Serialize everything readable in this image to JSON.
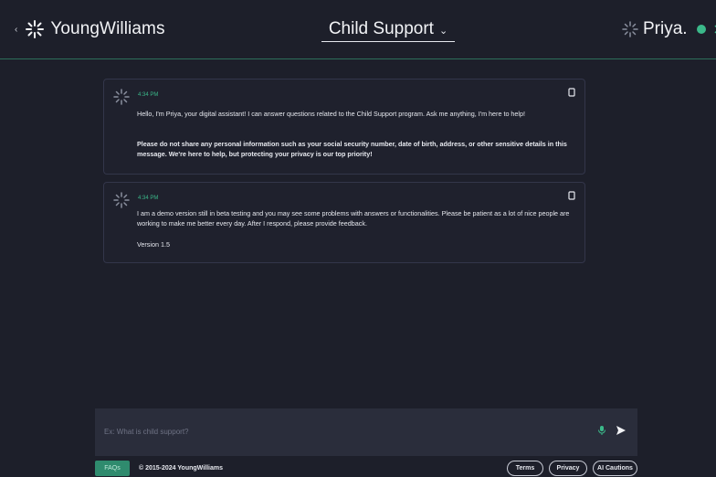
{
  "header": {
    "brand": "YoungWilliams",
    "title": "Child Support",
    "assistant_name": "Priya."
  },
  "messages": [
    {
      "time": "4:34 PM",
      "paragraphs": [
        "Hello, I'm Priya, your digital assistant! I can answer questions related to the Child Support program. Ask me anything, I'm here to help!",
        "Please do not share any personal information such as your social security number, date of birth, address, or other sensitive details in this message. We're here to help, but protecting your privacy is our top priority!"
      ]
    },
    {
      "time": "4:34 PM",
      "paragraphs": [
        "I am a demo version still in beta testing and you may see some problems with answers or functionalities. Please be patient as a lot of nice people are working to make me better every day. After I respond, please provide feedback.",
        "Version 1.5"
      ]
    }
  ],
  "composer": {
    "placeholder": "Ex: What is child support?"
  },
  "footer": {
    "faqs": "FAQs",
    "copyright": "© 2015-2024 YoungWilliams",
    "terms": "Terms",
    "privacy": "Privacy",
    "ai_cautions": "AI Cautions"
  },
  "colors": {
    "background": "#1d1f2a",
    "accent": "#3bb98a",
    "faq_button": "#2f8b6e"
  }
}
